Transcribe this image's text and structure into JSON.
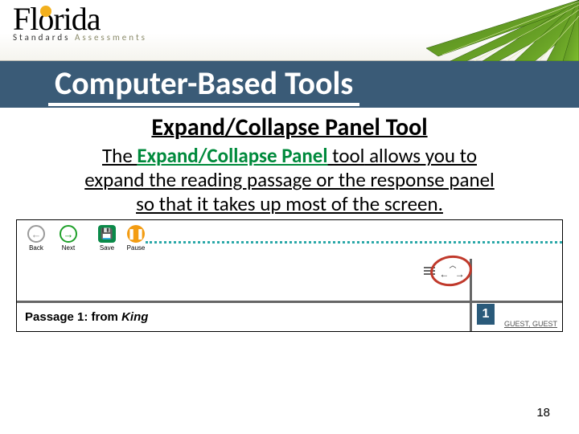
{
  "header": {
    "logo_main": "Florida",
    "logo_sub_a": "Standards",
    "logo_sub_b": "Assessments"
  },
  "title": "Computer-Based Tools",
  "subtitle": "Expand/Collapse Panel Tool",
  "paragraph": {
    "lead": "The ",
    "tool_name": "Expand/Collapse Panel",
    "mid": " tool",
    "rest1": " allows you to",
    "line2": "expand the reading passage or the response panel",
    "line3": "so that it takes up most of the screen."
  },
  "screenshot": {
    "buttons": {
      "back": "Back",
      "next": "Next",
      "save": "Save",
      "pause": "Pause"
    },
    "expand_arrows": "← →",
    "passage_prefix": "Passage 1: from ",
    "passage_title": "King",
    "question_number": "1",
    "guest": "GUEST, GUEST"
  },
  "page_number": "18"
}
